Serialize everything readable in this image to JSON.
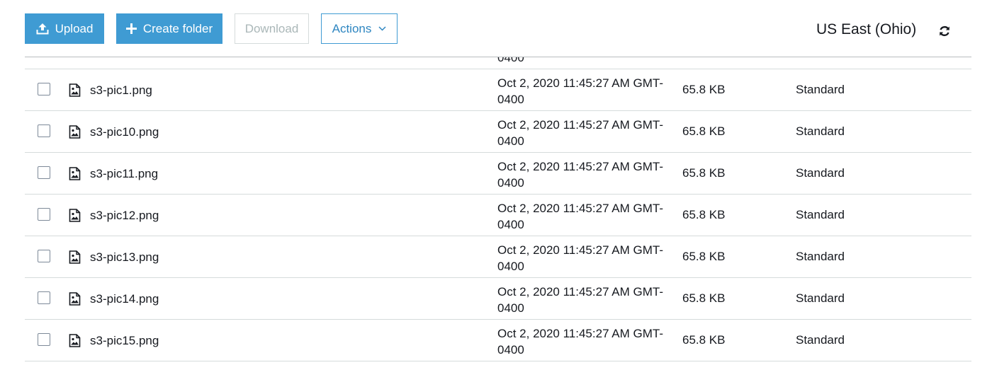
{
  "toolbar": {
    "upload_label": "Upload",
    "create_folder_label": "Create folder",
    "download_label": "Download",
    "actions_label": "Actions",
    "region": "US East (Ohio)"
  },
  "colors": {
    "primary_button": "#3f9bd3",
    "actions_text": "#2e86c1",
    "disabled_text": "#aab7b8"
  },
  "icons": {
    "upload": "upload-icon",
    "create_folder": "plus-icon",
    "actions": "chevron-down-icon",
    "refresh": "refresh-icon",
    "file": "image-file-icon"
  },
  "partial_row": {
    "date_fragment": "0400"
  },
  "files": [
    {
      "name": "s3-pic1.png",
      "date_line1": "Oct 2, 2020 11:45:27 AM GMT-",
      "date_line2": "0400",
      "size": "65.8 KB",
      "storage_class": "Standard"
    },
    {
      "name": "s3-pic10.png",
      "date_line1": "Oct 2, 2020 11:45:27 AM GMT-",
      "date_line2": "0400",
      "size": "65.8 KB",
      "storage_class": "Standard"
    },
    {
      "name": "s3-pic11.png",
      "date_line1": "Oct 2, 2020 11:45:27 AM GMT-",
      "date_line2": "0400",
      "size": "65.8 KB",
      "storage_class": "Standard"
    },
    {
      "name": "s3-pic12.png",
      "date_line1": "Oct 2, 2020 11:45:27 AM GMT-",
      "date_line2": "0400",
      "size": "65.8 KB",
      "storage_class": "Standard"
    },
    {
      "name": "s3-pic13.png",
      "date_line1": "Oct 2, 2020 11:45:27 AM GMT-",
      "date_line2": "0400",
      "size": "65.8 KB",
      "storage_class": "Standard"
    },
    {
      "name": "s3-pic14.png",
      "date_line1": "Oct 2, 2020 11:45:27 AM GMT-",
      "date_line2": "0400",
      "size": "65.8 KB",
      "storage_class": "Standard"
    },
    {
      "name": "s3-pic15.png",
      "date_line1": "Oct 2, 2020 11:45:27 AM GMT-",
      "date_line2": "0400",
      "size": "65.8 KB",
      "storage_class": "Standard"
    }
  ]
}
